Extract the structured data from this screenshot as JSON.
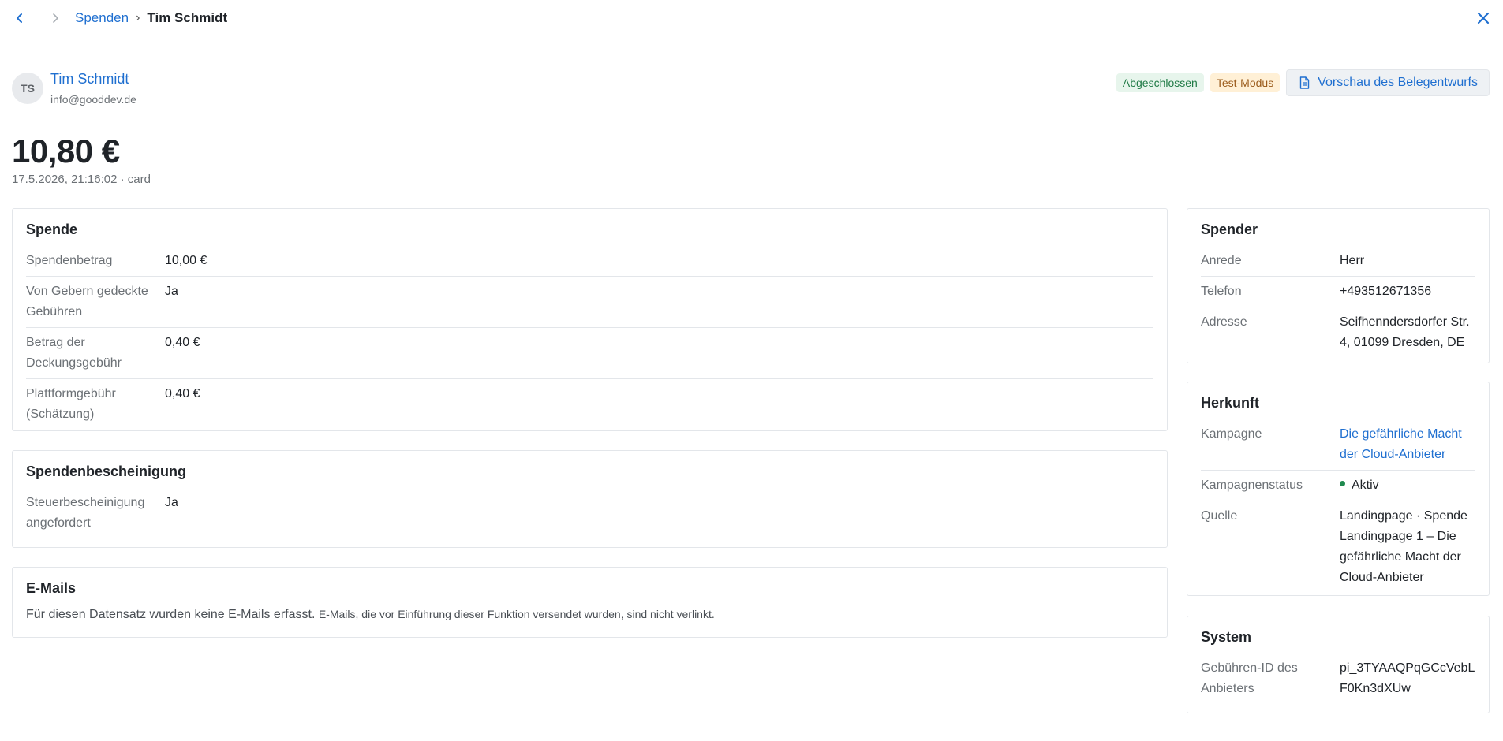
{
  "topbar": {
    "breadcrumb_parent": "Spenden",
    "breadcrumb_sep": "›",
    "breadcrumb_current": "Tim Schmidt"
  },
  "header": {
    "avatar_initials": "TS",
    "name": "Tim Schmidt",
    "email": "info@gooddev.de",
    "badge_status": "Abgeschlossen",
    "badge_mode": "Test-Modus",
    "preview_label": "Vorschau des Belegentwurfs"
  },
  "summary": {
    "amount": "10,80 €",
    "meta": "17.5.2026, 21:16:02  · card"
  },
  "spende": {
    "title": "Spende",
    "rows": [
      {
        "label": "Spendenbetrag",
        "value": "10,00 €"
      },
      {
        "label": "Von Gebern gedeckte Gebühren",
        "value": "Ja"
      },
      {
        "label": "Betrag der Deckungsgebühr",
        "value": "0,40 €"
      },
      {
        "label": "Plattformgebühr (Schätzung)",
        "value": "0,40 €"
      }
    ]
  },
  "bescheinigung": {
    "title": "Spendenbescheinigung",
    "rows": [
      {
        "label": "Steuerbescheinigung angefordert",
        "value": "Ja"
      }
    ]
  },
  "emails": {
    "title": "E-Mails",
    "text": "Für diesen Datensatz wurden keine E-Mails erfasst.",
    "note": "E-Mails, die vor Einführung dieser Funktion versendet wurden, sind nicht verlinkt."
  },
  "spender": {
    "title": "Spender",
    "rows": [
      {
        "label": "Anrede",
        "value": "Herr"
      },
      {
        "label": "Telefon",
        "value": "+493512671356"
      },
      {
        "label": "Adresse",
        "value": "Seifhenndersdorfer Str. 4, 01099 Dresden, DE"
      }
    ]
  },
  "herkunft": {
    "title": "Herkunft",
    "rows": [
      {
        "label": "Kampagne",
        "value": "Die gefährliche Macht der Cloud-Anbieter"
      },
      {
        "label": "Kampagnenstatus",
        "value": "Aktiv"
      },
      {
        "label": "Quelle",
        "value": "Landingpage · Spende Landingpage 1 – Die gefährliche Macht der Cloud-Anbieter"
      }
    ]
  },
  "system": {
    "title": "System",
    "rows": [
      {
        "label": "Gebühren-ID des Anbieters",
        "value": "pi_3TYAAQPqGCcVebLF0Kn3dXUw"
      }
    ]
  },
  "colors": {
    "accent": "#1f6fd0",
    "success": "#1f8a4f",
    "warning_bg": "#fff0d6"
  }
}
